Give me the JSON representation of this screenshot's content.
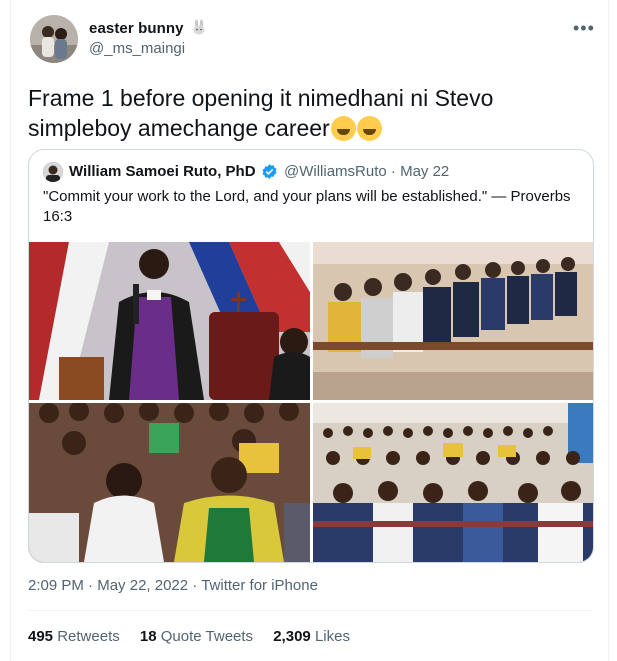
{
  "author": {
    "name": "easter bunny",
    "handle": "@_ms_maingi",
    "badge_icon": "rabbit-icon"
  },
  "tweet": {
    "text": "Frame 1 before opening it nimedhani ni Stevo simpleboy amechange career",
    "emojis": [
      "grinning-sweat-emoji",
      "tears-of-joy-emoji"
    ]
  },
  "quoted": {
    "name": "William Samoei Ruto, PhD",
    "verified": true,
    "handle": "@WilliamsRuto",
    "date": "· May 22",
    "text": "\"Commit your work to the Lord, and your plans will be established.\" — Proverbs 16:3",
    "photos": [
      "preacher-photo",
      "front-row-photo",
      "congregation-closeup-photo",
      "congregation-wide-photo"
    ]
  },
  "meta": {
    "time": "2:09 PM",
    "date": "May 22, 2022",
    "source": "Twitter for iPhone"
  },
  "stats": {
    "retweets_count": "495",
    "retweets_label": "Retweets",
    "quotes_count": "18",
    "quotes_label": "Quote Tweets",
    "likes_count": "2,309",
    "likes_label": "Likes"
  },
  "colors": {
    "text": "#0f1419",
    "secondary": "#536471",
    "verified": "#1d9bf0",
    "border": "#cfd9de"
  }
}
